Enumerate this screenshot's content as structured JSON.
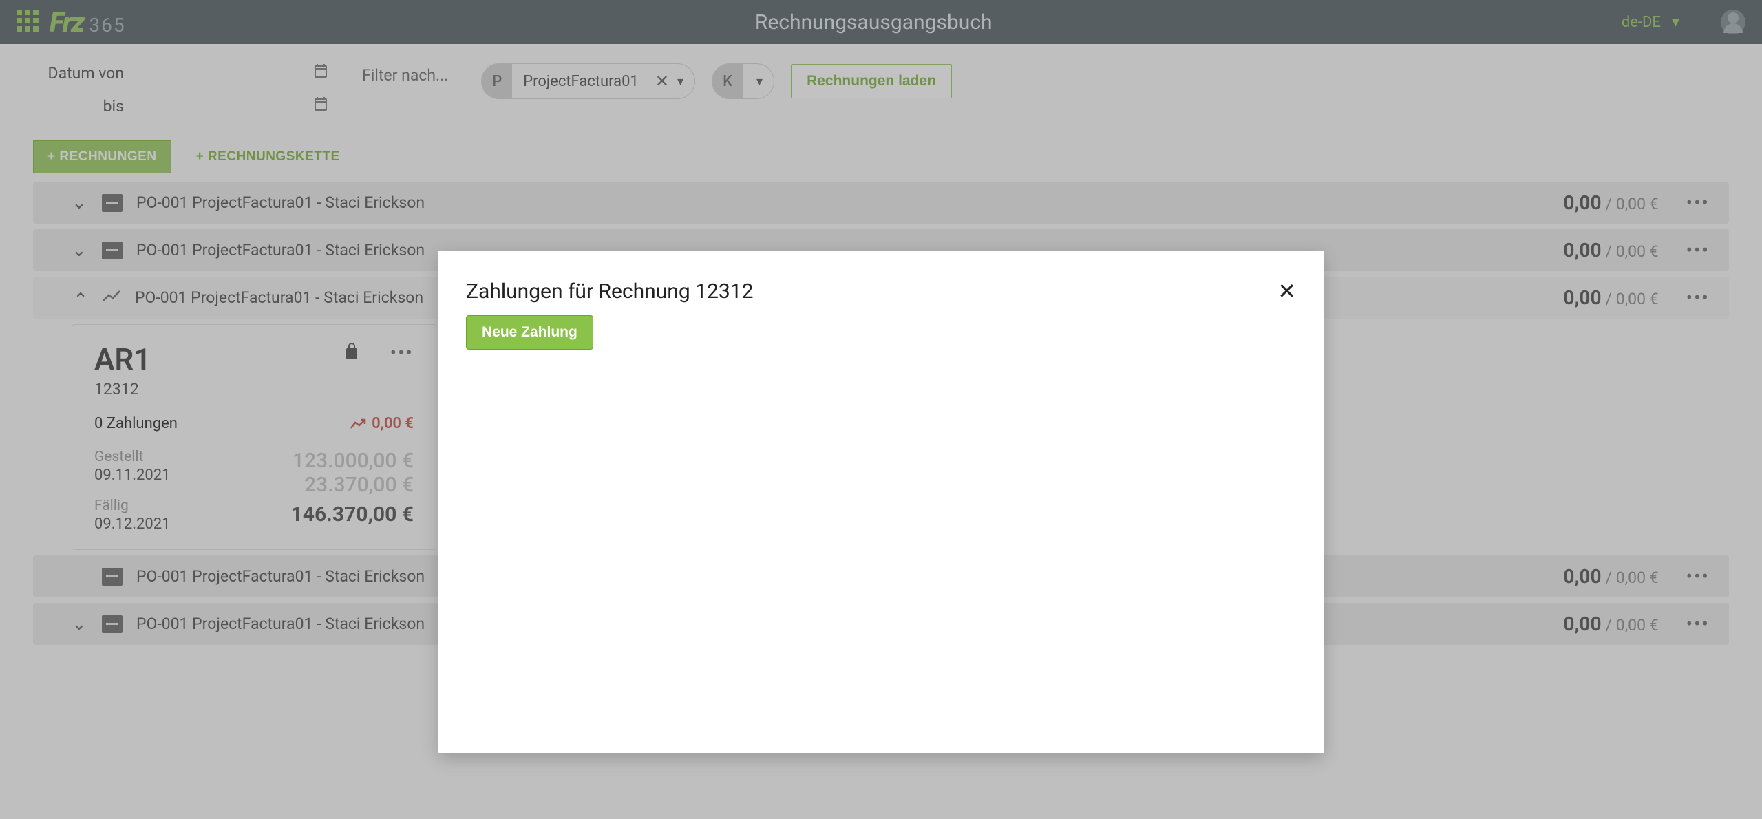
{
  "header": {
    "logo_mark": "Frz",
    "logo_suffix": "365",
    "title": "Rechnungsausgangsbuch",
    "lang": "de-DE"
  },
  "filters": {
    "date_from_label": "Datum von",
    "date_to_label": "bis",
    "filter_label": "Filter nach...",
    "project_badge": "P",
    "project_value": "ProjectFactura01",
    "customer_badge": "K",
    "load_label": "Rechnungen laden"
  },
  "actions": {
    "add_invoices": "+ RECHNUNGEN",
    "add_chain": "+ RECHNUNGSKETTE"
  },
  "rows": [
    {
      "text": "PO-001 ProjectFactura01 - Staci Erickson",
      "bold": "0,00",
      "rest": "/ 0,00 €",
      "expanded": false,
      "icon": "archive"
    },
    {
      "text": "PO-001 ProjectFactura01 - Staci Erickson",
      "bold": "0,00",
      "rest": "/ 0,00 €",
      "expanded": false,
      "icon": "archive"
    },
    {
      "text": "PO-001 ProjectFactura01 - Staci Erickson",
      "bold": "0,00",
      "rest": "/ 0,00 €",
      "expanded": true,
      "icon": "trend"
    },
    {
      "text": "PO-001 ProjectFactura01 - Staci Erickson",
      "bold": "0,00",
      "rest": "/ 0,00 €",
      "expanded": false,
      "icon": "archive",
      "nochev": true
    },
    {
      "text": "PO-001 ProjectFactura01 - Staci Erickson",
      "bold": "0,00",
      "rest": "/ 0,00 €",
      "expanded": false,
      "icon": "archive"
    }
  ],
  "card": {
    "title": "AR1",
    "number": "12312",
    "payments_text": "0 Zahlungen",
    "trend_amount": "0,00 €",
    "issued_label": "Gestellt",
    "issued_date": "09.11.2021",
    "due_label": "Fällig",
    "due_date": "09.12.2021",
    "net": "123.000,00 €",
    "tax": "23.370,00 €",
    "total": "146.370,00 €"
  },
  "dialog": {
    "title": "Zahlungen für Rechnung 12312",
    "new_payment": "Neue Zahlung"
  }
}
